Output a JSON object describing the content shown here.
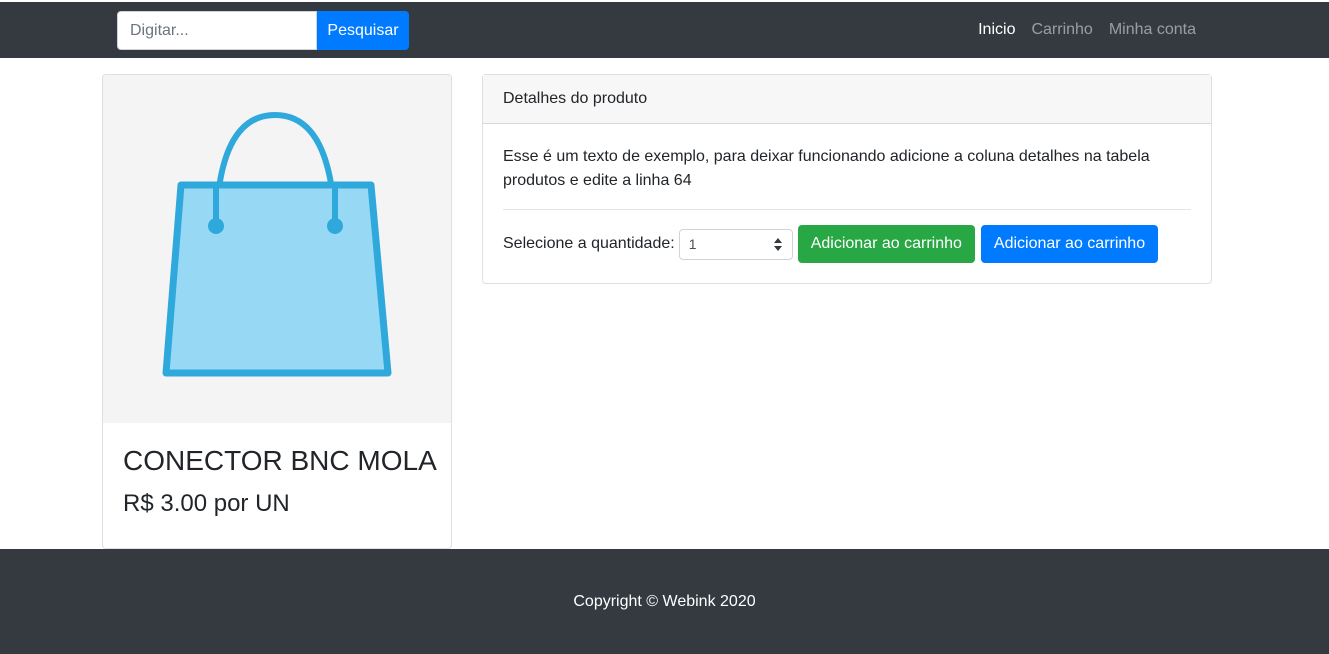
{
  "navbar": {
    "search_placeholder": "Digitar...",
    "search_button": "Pesquisar",
    "links": [
      {
        "label": "Inicio",
        "active": true
      },
      {
        "label": "Carrinho",
        "active": false
      },
      {
        "label": "Minha conta",
        "active": false
      }
    ]
  },
  "product": {
    "image_icon": "shopping-bag-icon",
    "title": "CONECTOR BNC MOLA",
    "price": "R$ 3.00 por UN"
  },
  "details": {
    "header": "Detalhes do produto",
    "text": "Esse é um texto de exemplo, para deixar funcionando adicione a coluna detalhes na tabela produtos e edite a linha 64",
    "quantity_label": "Selecione a quantidade:",
    "quantity_value": "1",
    "add_button_green": "Adicionar ao carrinho",
    "add_button_blue": "Adicionar ao carrinho"
  },
  "footer": {
    "copyright": "Copyright © Webink 2020"
  },
  "colors": {
    "navbar_bg": "#343a40",
    "primary": "#007bff",
    "success": "#28a745",
    "bag_fill": "#97d9f5",
    "bag_stroke": "#2fa9db"
  }
}
